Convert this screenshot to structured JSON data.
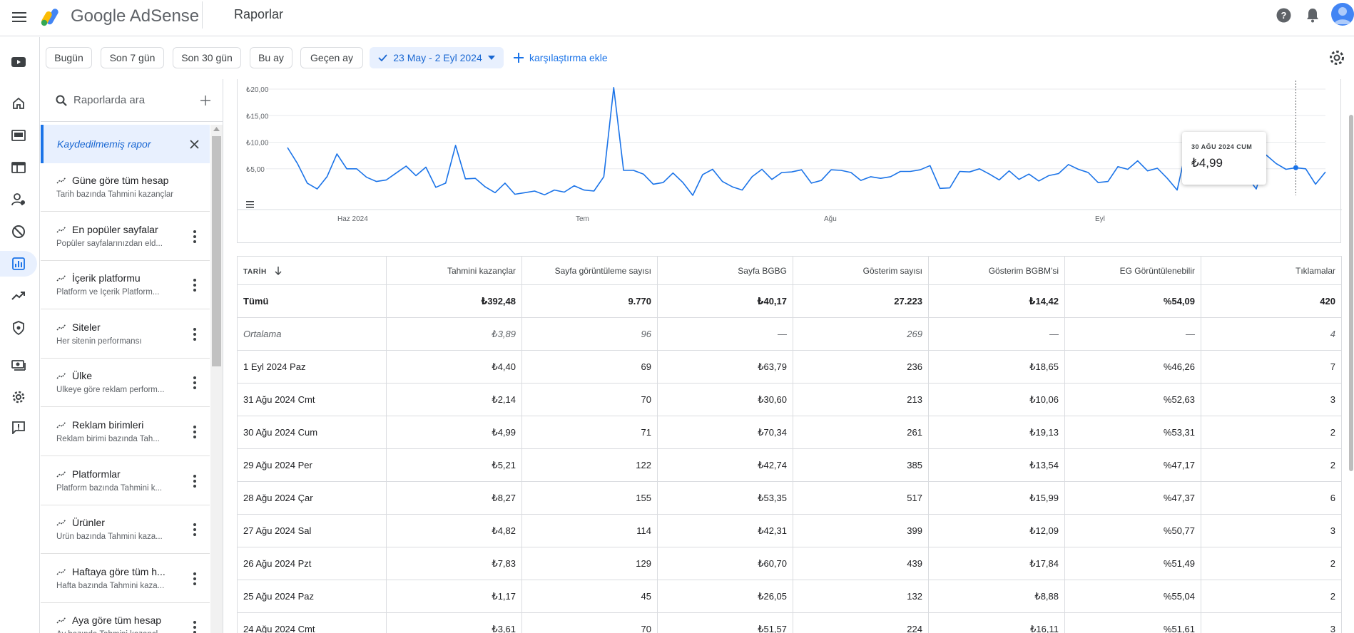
{
  "app": {
    "brand": "Google AdSense",
    "page_title": "Raporlar"
  },
  "filters": {
    "chips": [
      "Bugün",
      "Son 7 gün",
      "Son 30 gün",
      "Bu ay",
      "Geçen ay"
    ],
    "active_range": "23 May - 2 Eyl 2024",
    "compare_label": "karşılaştırma ekle"
  },
  "sidebar_reports": {
    "search_placeholder": "Raporlarda ara",
    "unsaved_label": "Kaydedilmemiş rapor",
    "items": [
      {
        "name": "Güne göre tüm hesap",
        "desc": "Tarih bazında Tahmini kazançlar"
      },
      {
        "name": "En popüler sayfalar",
        "desc": "Popüler sayfalarınızdan eld..."
      },
      {
        "name": "İçerik platformu",
        "desc": "Platform ve İçerik Platform..."
      },
      {
        "name": "Siteler",
        "desc": "Her sitenin performansı"
      },
      {
        "name": "Ülke",
        "desc": "Ülkeye göre reklam perform..."
      },
      {
        "name": "Reklam birimleri",
        "desc": "Reklam birimi bazında Tah..."
      },
      {
        "name": "Platformlar",
        "desc": "Platform bazında Tahmini k..."
      },
      {
        "name": "Ürünler",
        "desc": "Ürün bazında Tahmini kaza..."
      },
      {
        "name": "Haftaya göre tüm h...",
        "desc": "Hafta bazında Tahmini kaza..."
      },
      {
        "name": "Aya göre tüm hesap",
        "desc": "Ay bazında Tahmini kazançl..."
      }
    ]
  },
  "chart": {
    "y_ticks": [
      "₺20,00",
      "₺15,00",
      "₺10,00",
      "₺5,00"
    ],
    "x_labels": [
      "Haz 2024",
      "Tem",
      "Ağu",
      "Eyl"
    ],
    "tooltip_date": "30 AĞU 2024 CUM",
    "tooltip_value": "₺4,99"
  },
  "chart_data": {
    "type": "line",
    "title": "",
    "xlabel": "",
    "ylabel": "",
    "x_start": "23 May 2024",
    "x_end": "2 Eyl 2024",
    "ylim": [
      0,
      20
    ],
    "y_tick_values": [
      5,
      10,
      15,
      20
    ],
    "series": [
      {
        "values": [
          9.0,
          6.0,
          2.3,
          1.2,
          3.5,
          7.8,
          5.0,
          5.0,
          3.4,
          2.6,
          2.9,
          4.2,
          5.5,
          3.7,
          5.3,
          1.5,
          2.3,
          9.4,
          3.1,
          3.2,
          1.6,
          0.5,
          2.3,
          0.2,
          0.5,
          0.8,
          0.1,
          1.0,
          0.6,
          1.8,
          1.0,
          0.8,
          3.5,
          20.3,
          4.7,
          4.7,
          4.0,
          2.1,
          2.4,
          4.2,
          2.4,
          0.0,
          3.9,
          4.9,
          2.6,
          1.6,
          1.0,
          3.5,
          4.9,
          3.0,
          4.3,
          4.4,
          4.8,
          2.3,
          2.8,
          4.8,
          4.7,
          4.3,
          2.8,
          3.5,
          3.2,
          3.5,
          4.5,
          4.5,
          4.8,
          5.6,
          1.3,
          1.4,
          4.5,
          4.4,
          5.0,
          4.0,
          2.9,
          4.6,
          3.0,
          4.0,
          2.7,
          3.7,
          4.1,
          5.8,
          4.9,
          4.3,
          2.4,
          2.6,
          5.4,
          4.9,
          6.5,
          4.6,
          5.1,
          3.2,
          1.0,
          9.3,
          6.5,
          5.8,
          6.5,
          7.2,
          4.3,
          3.7,
          1.2,
          7.6,
          6.0,
          4.9,
          5.2,
          4.99,
          2.1,
          4.4
        ]
      }
    ]
  },
  "table": {
    "columns": [
      "TARİH",
      "Tahmini kazançlar",
      "Sayfa görüntüleme sayısı",
      "Sayfa BGBG",
      "Gösterim sayısı",
      "Gösterim BGBM'si",
      "EG Görüntülenebilir",
      "Tıklamalar"
    ],
    "total_row": [
      "Tümü",
      "₺392,48",
      "9.770",
      "₺40,17",
      "27.223",
      "₺14,42",
      "%54,09",
      "420"
    ],
    "average_row": [
      "Ortalama",
      "₺3,89",
      "96",
      "—",
      "269",
      "—",
      "—",
      "4"
    ],
    "rows": [
      [
        "1 Eyl 2024 Paz",
        "₺4,40",
        "69",
        "₺63,79",
        "236",
        "₺18,65",
        "%46,26",
        "7"
      ],
      [
        "31 Ağu 2024 Cmt",
        "₺2,14",
        "70",
        "₺30,60",
        "213",
        "₺10,06",
        "%52,63",
        "3"
      ],
      [
        "30 Ağu 2024 Cum",
        "₺4,99",
        "71",
        "₺70,34",
        "261",
        "₺19,13",
        "%53,31",
        "2"
      ],
      [
        "29 Ağu 2024 Per",
        "₺5,21",
        "122",
        "₺42,74",
        "385",
        "₺13,54",
        "%47,17",
        "2"
      ],
      [
        "28 Ağu 2024 Çar",
        "₺8,27",
        "155",
        "₺53,35",
        "517",
        "₺15,99",
        "%47,37",
        "6"
      ],
      [
        "27 Ağu 2024 Sal",
        "₺4,82",
        "114",
        "₺42,31",
        "399",
        "₺12,09",
        "%50,77",
        "3"
      ],
      [
        "26 Ağu 2024 Pzt",
        "₺7,83",
        "129",
        "₺60,70",
        "439",
        "₺17,84",
        "%51,49",
        "2"
      ],
      [
        "25 Ağu 2024 Paz",
        "₺1,17",
        "45",
        "₺26,05",
        "132",
        "₺8,88",
        "%55,04",
        "2"
      ],
      [
        "24 Ağu 2024 Cmt",
        "₺3,61",
        "70",
        "₺51,57",
        "224",
        "₺16,11",
        "%51,61",
        "3"
      ]
    ]
  },
  "colors": {
    "accent": "#1a73e8",
    "chip_active_bg": "#e8f0fe",
    "border": "#dadce0"
  }
}
